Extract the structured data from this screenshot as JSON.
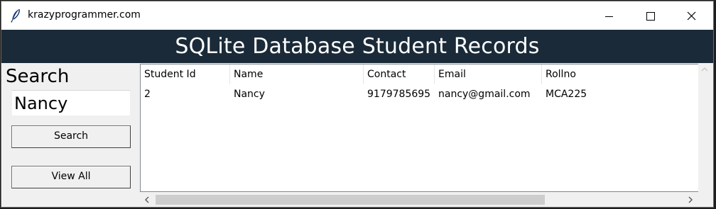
{
  "window": {
    "title": "krazyprogrammer.com",
    "app_icon": "feather-icon"
  },
  "banner": {
    "title": "SQLite Database Student Records",
    "background": "#1a2a38",
    "color": "#ffffff"
  },
  "sidebar": {
    "search_label": "Search",
    "search_value": "Nancy",
    "search_button": "Search",
    "view_all_button": "View All"
  },
  "table": {
    "columns": [
      "Student Id",
      "Name",
      "Contact",
      "Email",
      "Rollno"
    ],
    "rows": [
      [
        "2",
        "Nancy",
        "9179785695",
        "nancy@gmail.com",
        "MCA225"
      ]
    ]
  }
}
